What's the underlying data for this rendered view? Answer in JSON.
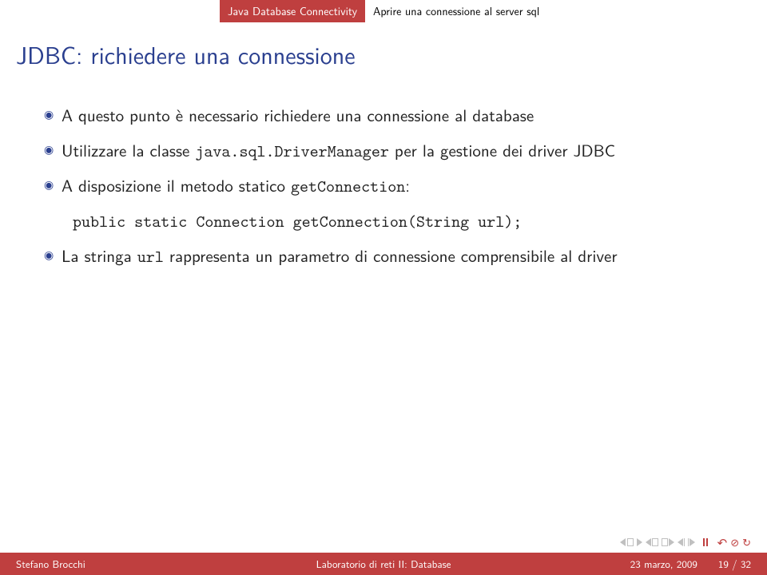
{
  "header": {
    "section": "Java Database Connectivity",
    "subsection": "Aprire una connessione al server sql"
  },
  "title": "JDBC: richiedere una connessione",
  "bullets": [
    {
      "prefix": "A questo punto è necessario richiedere una connessione al database"
    },
    {
      "prefix": "Utilizzare la classe ",
      "code": "java.sql.DriverManager",
      "suffix": " per la gestione dei driver JDBC"
    },
    {
      "prefix": "A disposizione il metodo statico ",
      "code": "getConnection",
      "suffix": ":"
    }
  ],
  "codeLine": "public static Connection getConnection(String url);",
  "lastBullet": {
    "prefix": "La stringa ",
    "code": "url",
    "suffix": " rappresenta un parametro di connessione comprensibile al driver"
  },
  "footer": {
    "author": "Stefano Brocchi",
    "course": "Laboratorio di reti II: Database",
    "date": "23 marzo, 2009",
    "page": "19 / 32"
  }
}
